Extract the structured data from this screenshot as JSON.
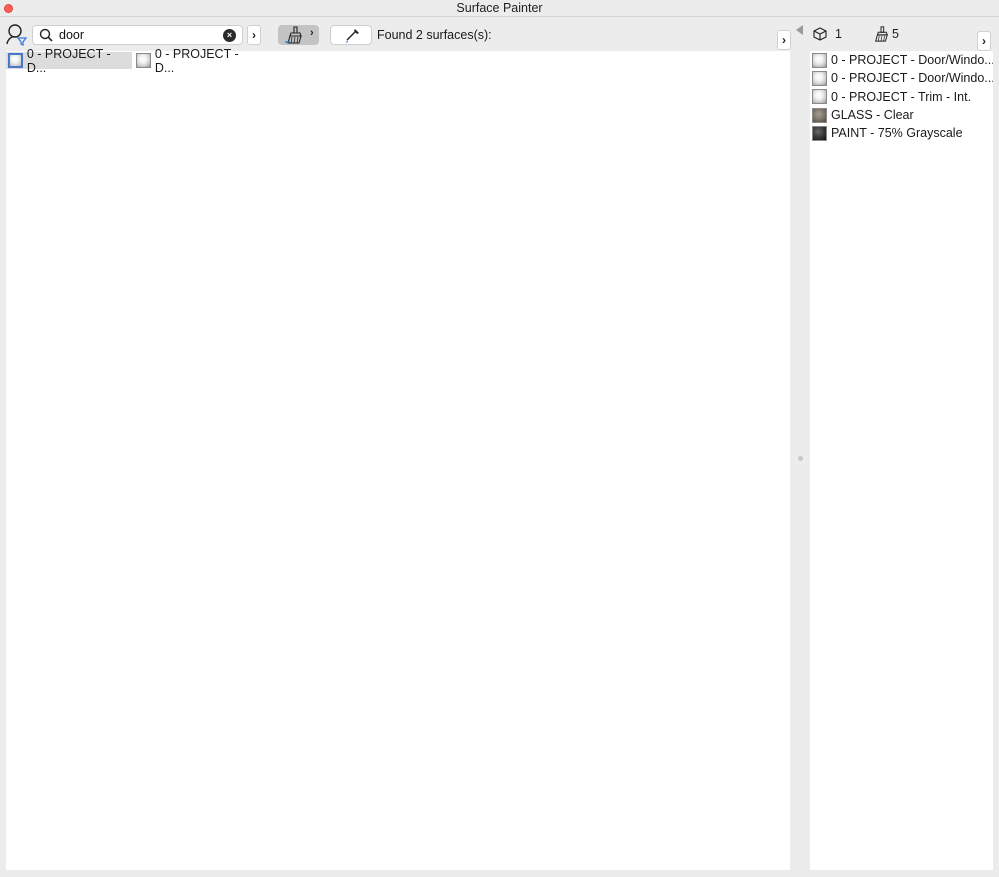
{
  "window": {
    "title": "Surface Painter"
  },
  "search": {
    "value": "door",
    "clear_glyph": "×",
    "more_glyph": "›"
  },
  "toolbar": {
    "brush_more_glyph": "›",
    "found_label": "Found 2 surfaces(s):",
    "panel_toggle_glyph": "›"
  },
  "results": [
    {
      "label": "0 - PROJECT - D...",
      "selected": true
    },
    {
      "label": "0 - PROJECT - D...",
      "selected": false
    }
  ],
  "right_panel": {
    "object_count": "1",
    "surface_count": "5",
    "more_glyph": "›",
    "items": [
      {
        "label": "0 - PROJECT - Door/Windo...",
        "material": "white"
      },
      {
        "label": "0 - PROJECT - Door/Windo...",
        "material": "white"
      },
      {
        "label": "0 - PROJECT - Trim - Int.",
        "material": "white"
      },
      {
        "label": "GLASS - Clear",
        "material": "glass"
      },
      {
        "label": "PAINT -  75% Grayscale",
        "material": "paint"
      }
    ]
  },
  "icons": {
    "filter": "filter-person-icon",
    "search": "magnifier-icon",
    "clear": "clear-circle-icon",
    "brush": "paint-brush-icon",
    "picker": "eyedropper-icon",
    "object": "cube-icon",
    "surface": "paint-brush-icon"
  },
  "colors": {
    "window_bg": "#ececec",
    "list_bg": "#ffffff",
    "selection": "#dcdcdc",
    "close_button": "#ff5f57",
    "filter_accent": "#3a7bd5"
  }
}
